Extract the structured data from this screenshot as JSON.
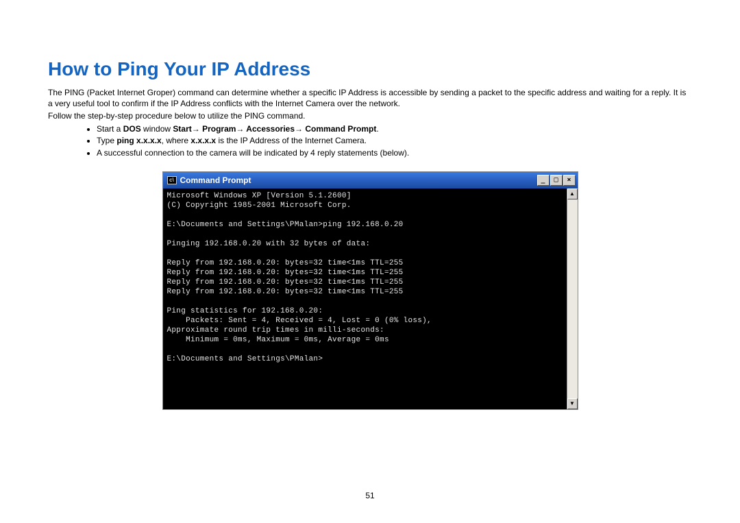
{
  "title": "How to Ping Your IP Address",
  "intro": "The PING (Packet Internet Groper) command can determine whether a specific IP Address is accessible by sending a packet to the specific address and waiting for a reply. It is a very useful tool to confirm if the IP Address conflicts with the Internet Camera over the network.",
  "follow": "Follow the step-by-step procedure below to utilize the PING command.",
  "steps": {
    "s1_pre": "Start a ",
    "s1_b1": "DOS",
    "s1_mid": " window ",
    "s1_b2": "Start",
    "s1_arrow": "→",
    "s1_b3": " Program",
    "s1_b4": " Accessories",
    "s1_b5": " Command Prompt",
    "s1_end": ".",
    "s2_pre": "Type ",
    "s2_b1": "ping x.x.x.x",
    "s2_mid": ", where ",
    "s2_b2": "x.x.x.x",
    "s2_end": " is the IP Address of the Internet Camera.",
    "s3": "A successful connection to the camera will be indicated by 4 reply statements (below)."
  },
  "cmd": {
    "icon_glyph": "c\\",
    "title": "Command Prompt",
    "min": "_",
    "max": "□",
    "close": "×",
    "up": "▲",
    "down": "▼",
    "lines": "Microsoft Windows XP [Version 5.1.2600]\n(C) Copyright 1985-2001 Microsoft Corp.\n\nE:\\Documents and Settings\\PMalan>ping 192.168.0.20\n\nPinging 192.168.0.20 with 32 bytes of data:\n\nReply from 192.168.0.20: bytes=32 time<1ms TTL=255\nReply from 192.168.0.20: bytes=32 time<1ms TTL=255\nReply from 192.168.0.20: bytes=32 time<1ms TTL=255\nReply from 192.168.0.20: bytes=32 time<1ms TTL=255\n\nPing statistics for 192.168.0.20:\n    Packets: Sent = 4, Received = 4, Lost = 0 (0% loss),\nApproximate round trip times in milli-seconds:\n    Minimum = 0ms, Maximum = 0ms, Average = 0ms\n\nE:\\Documents and Settings\\PMalan>"
  },
  "page_number": "51"
}
